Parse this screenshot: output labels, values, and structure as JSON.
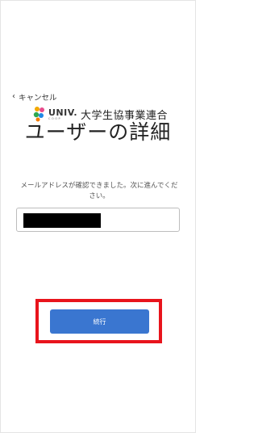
{
  "nav": {
    "cancel_label": "キャンセル"
  },
  "brand": {
    "logo_word": "UNIV.",
    "logo_sub": "COOP",
    "org_name": "大学生協事業連合"
  },
  "page": {
    "title": "ユーザーの詳細",
    "message": "メールアドレスが確認できました。次に進んでください。"
  },
  "form": {
    "email_value": ""
  },
  "actions": {
    "continue_label": "続行"
  },
  "colors": {
    "primary_button": "#3a76d0",
    "highlight_border": "#e8141c"
  }
}
